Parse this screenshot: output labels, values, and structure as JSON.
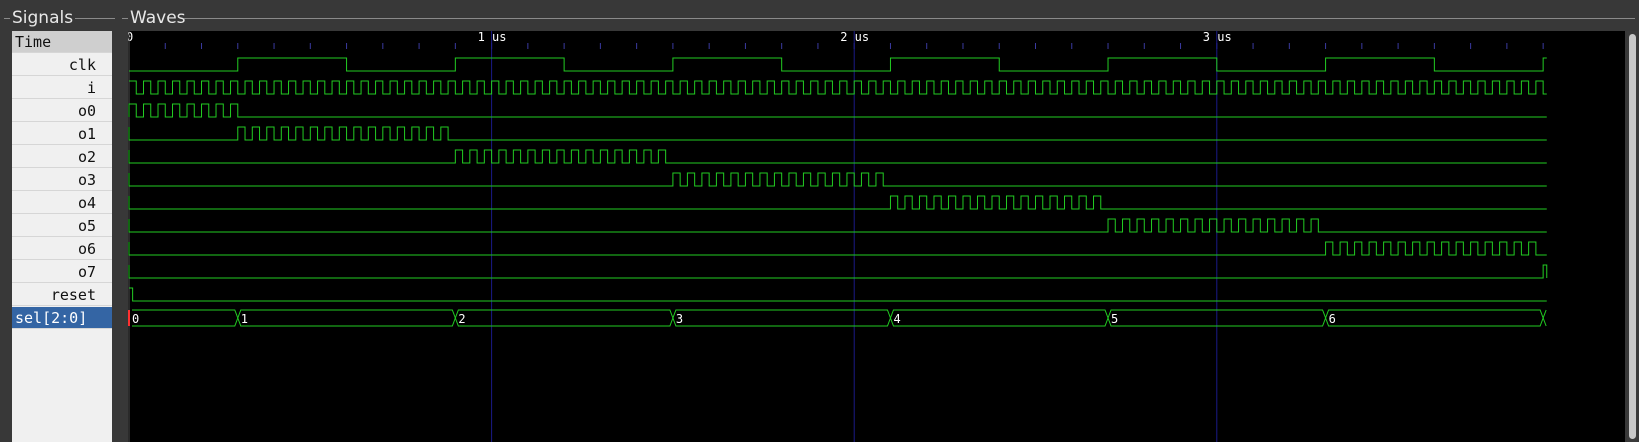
{
  "signals_panel": {
    "title": "Signals"
  },
  "waves_panel": {
    "title": "Waves"
  },
  "signals": [
    {
      "label": "Time"
    },
    {
      "label": "clk"
    },
    {
      "label": "i"
    },
    {
      "label": "o0"
    },
    {
      "label": "o1"
    },
    {
      "label": "o2"
    },
    {
      "label": "o3"
    },
    {
      "label": "o4"
    },
    {
      "label": "o5"
    },
    {
      "label": "o6"
    },
    {
      "label": "o7"
    },
    {
      "label": "reset"
    },
    {
      "label": "sel[2:0]"
    }
  ],
  "time_axis": {
    "ticks": [
      "0",
      "1 us",
      "2 us",
      "3 us"
    ],
    "end_us": 3.91
  },
  "waveform": {
    "clk_period_us": 0.6,
    "i_period_us": 0.04,
    "reset_high_until_us": 0.01,
    "selected_signal": "sel[2:0]",
    "sel_values": [
      "0",
      "1",
      "2",
      "3",
      "4",
      "5",
      "6"
    ],
    "sel_change_us": [
      0.3,
      0.9,
      1.5,
      2.1,
      2.7,
      3.3,
      3.9
    ]
  },
  "colors": {
    "trace": "#22cc22",
    "grid": "#1a1a88",
    "sel_first": "#ff3030",
    "value_text": "#ffffff"
  }
}
